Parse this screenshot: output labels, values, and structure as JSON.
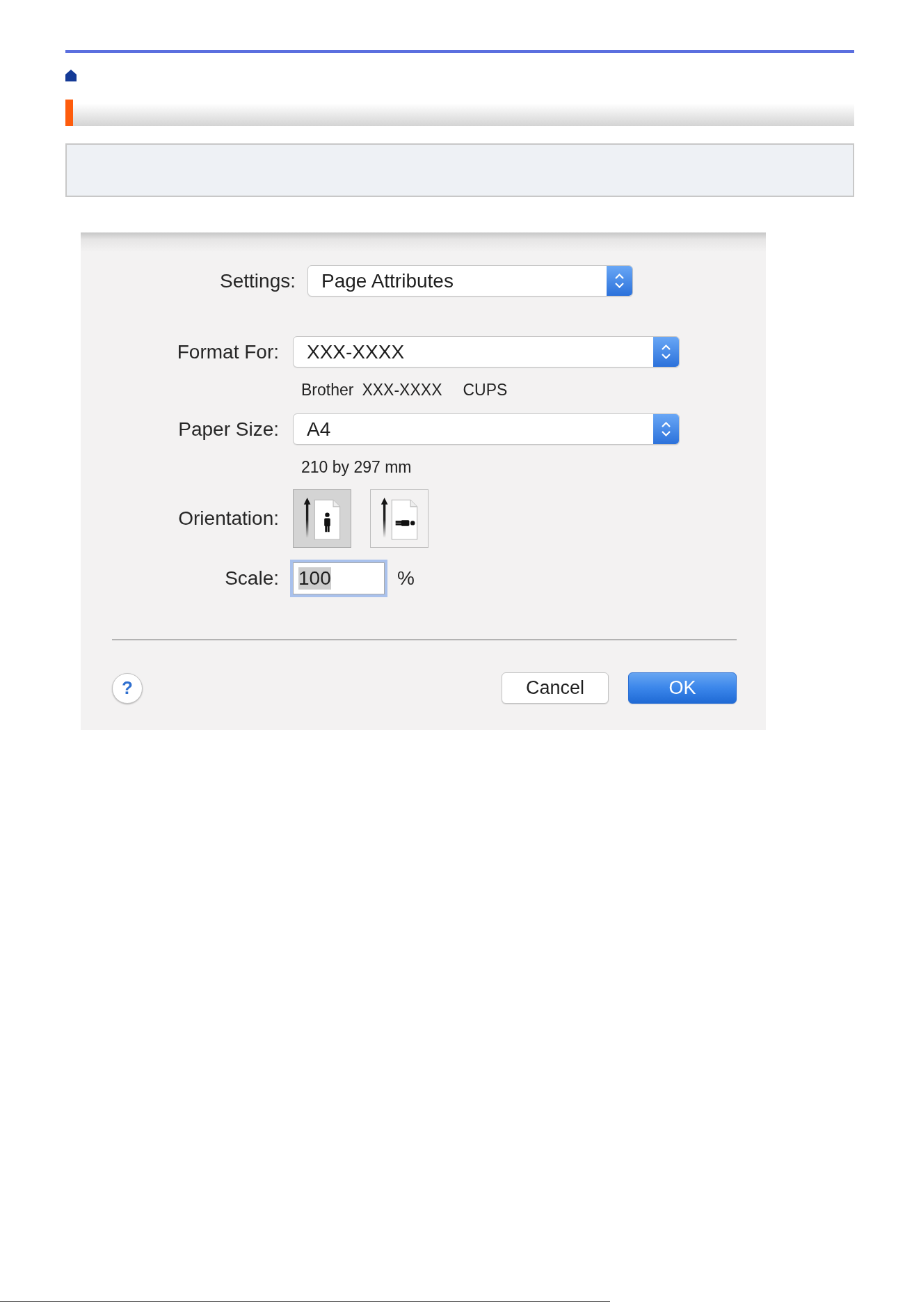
{
  "dialog": {
    "settings": {
      "label": "Settings:",
      "value": "Page Attributes"
    },
    "format_for": {
      "label": "Format For:",
      "value": "XXX-XXXX",
      "details": [
        "Brother",
        "XXX-XXXX",
        "CUPS"
      ]
    },
    "paper_size": {
      "label": "Paper Size:",
      "value": "A4",
      "details": [
        "210 by 297 mm"
      ]
    },
    "orientation": {
      "label": "Orientation:",
      "options": [
        {
          "kind": "portrait",
          "selected": true
        },
        {
          "kind": "landscape",
          "selected": false
        }
      ]
    },
    "scale": {
      "label": "Scale:",
      "value": "100",
      "unit": "%",
      "focused": true
    },
    "help_button": {
      "label": "?"
    },
    "buttons": [
      {
        "label": "Cancel",
        "kind": "cancel"
      },
      {
        "label": "OK",
        "kind": "confirm"
      }
    ]
  }
}
